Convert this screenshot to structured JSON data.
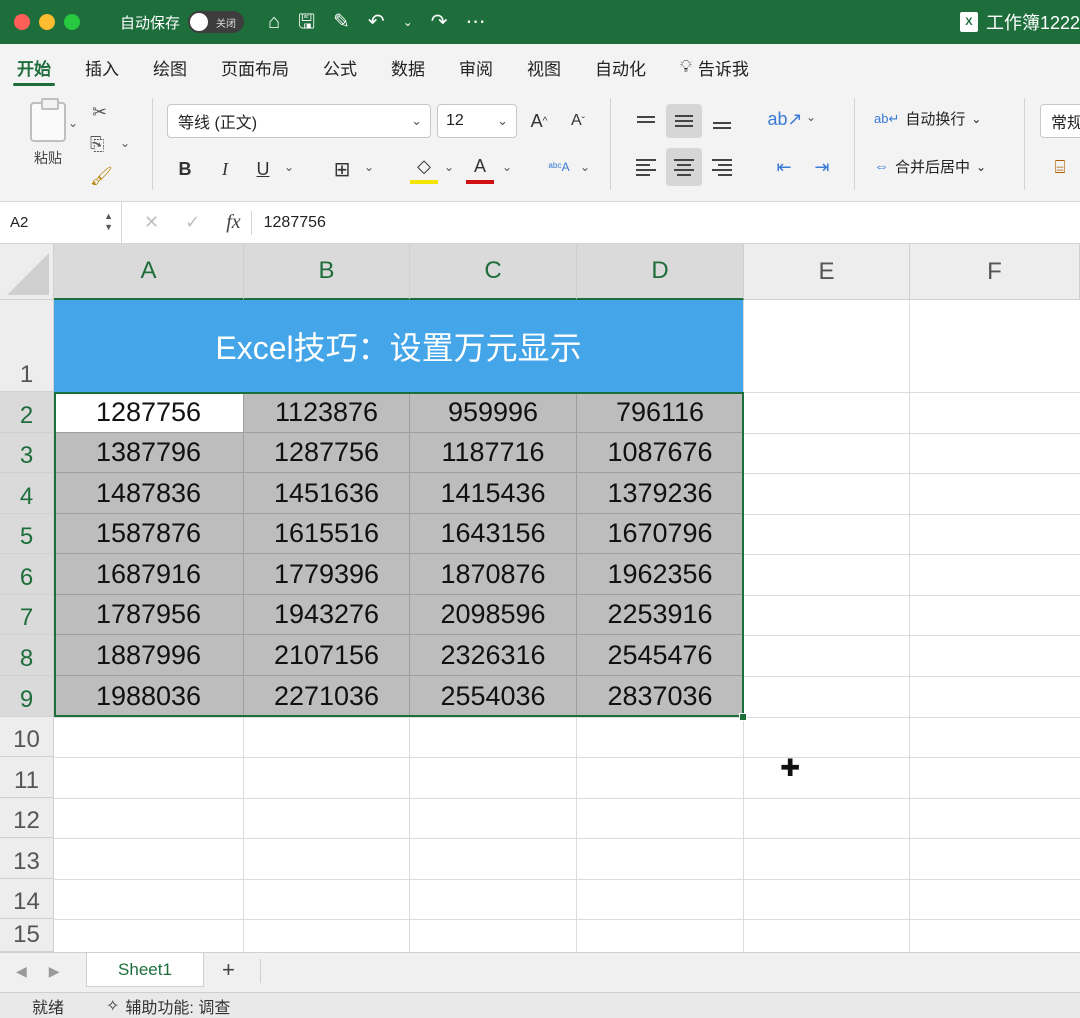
{
  "titlebar": {
    "autosave_label": "自动保存",
    "autosave_state": "关闭",
    "workbook_title": "工作簿1222"
  },
  "menu": {
    "tabs": [
      "开始",
      "插入",
      "绘图",
      "页面布局",
      "公式",
      "数据",
      "审阅",
      "视图",
      "自动化"
    ],
    "tell_me": "告诉我"
  },
  "ribbon": {
    "paste_label": "粘贴",
    "font_name": "等线 (正文)",
    "font_size": "12",
    "bold": "B",
    "italic": "I",
    "underline": "U",
    "wrap_text": "自动换行",
    "merge_center": "合并后居中",
    "number_format": "常规"
  },
  "formula_bar": {
    "name_box": "A2",
    "fx": "fx",
    "value": "1287756"
  },
  "columns": [
    "A",
    "B",
    "C",
    "D",
    "E",
    "F"
  ],
  "rows": [
    "1",
    "2",
    "3",
    "4",
    "5",
    "6",
    "7",
    "8",
    "9",
    "10",
    "11",
    "12",
    "13",
    "14",
    "15"
  ],
  "banner_title": "Excel技巧：设置万元显示",
  "table": [
    [
      "1287756",
      "1123876",
      "959996",
      "796116"
    ],
    [
      "1387796",
      "1287756",
      "1187716",
      "1087676"
    ],
    [
      "1487836",
      "1451636",
      "1415436",
      "1379236"
    ],
    [
      "1587876",
      "1615516",
      "1643156",
      "1670796"
    ],
    [
      "1687916",
      "1779396",
      "1870876",
      "1962356"
    ],
    [
      "1787956",
      "1943276",
      "2098596",
      "2253916"
    ],
    [
      "1887996",
      "2107156",
      "2326316",
      "2545476"
    ],
    [
      "1988036",
      "2271036",
      "2554036",
      "2837036"
    ]
  ],
  "sheets": {
    "active": "Sheet1",
    "add": "+"
  },
  "status": {
    "ready": "就绪",
    "accessibility": "辅助功能: 调查"
  },
  "colors": {
    "accent": "#1e6e3c",
    "banner": "#44a5e8",
    "selection_fill": "#bdbdbd"
  }
}
